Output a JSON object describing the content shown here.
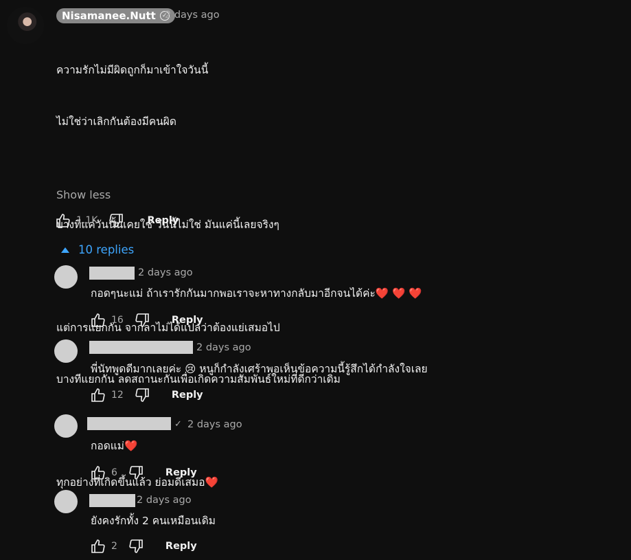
{
  "comment": {
    "author": "Nisamanee.Nutt",
    "verified_icon": "verified-check-icon",
    "time": "2 days ago",
    "lines": [
      "ความรักไม่มีผิดถูกก็มาเข้าใจวันนี้",
      "ไม่ใช่ว่าเลิกกันต้องมีคนผิด",
      "",
      "บางทีแค่วันนั้นเคยใช่ วันนี้ไม่ใช่ มันแค่นี้เลยจริงๆ",
      "",
      "แต่การแยกกัน จากลาไม่ได้แปลว่าต้องแย่เสมอไป",
      "บางทีแยกกัน ลดสถานะกันเพื่อเกิดความสัมพันธ์ใหม่ที่ดีกว่าเดิม",
      "",
      "ทุกอย่างที่เกิดขึ้นแล้ว ย่อมดีเสมอ"
    ],
    "last_line_emoji": "❤️",
    "show_less": "Show less",
    "like_count": "1.1K",
    "reply_label": "Reply"
  },
  "replies_toggle": {
    "label": "10 replies",
    "icon": "caret-up-icon"
  },
  "replies": [
    {
      "time": "2 days ago",
      "text": "กอดๆนะแม่ ถ้าเรารักกันมากพอเราจะหาทางกลับมาอีกจนได้ค่ะ",
      "emoji": "❤️ ❤️ ❤️",
      "likes": "16",
      "reply_label": "Reply",
      "verified": false
    },
    {
      "time": "2 days ago",
      "text": "พี่นัทพูดดีมากเลยค่ะ 😢  หนูก็กำลังเศร้าพอเห็นข้อความนี้รู้สึกได้กำลังใจเลย",
      "emoji": "",
      "likes": "12",
      "reply_label": "Reply",
      "verified": false
    },
    {
      "time": "2 days ago",
      "text": "กอดแม่",
      "emoji": "❤️",
      "likes": "6",
      "reply_label": "Reply",
      "verified": true
    },
    {
      "time": "2 days ago",
      "text": "ยังคงรักทั้ง 2 คนเหมือนเดิม",
      "emoji": "",
      "likes": "2",
      "reply_label": "Reply",
      "verified": false
    }
  ],
  "colors": {
    "background": "#0f0f0f",
    "link_blue": "#3ea6ff",
    "muted": "#aaaaaa",
    "heart": "#e8202a"
  }
}
